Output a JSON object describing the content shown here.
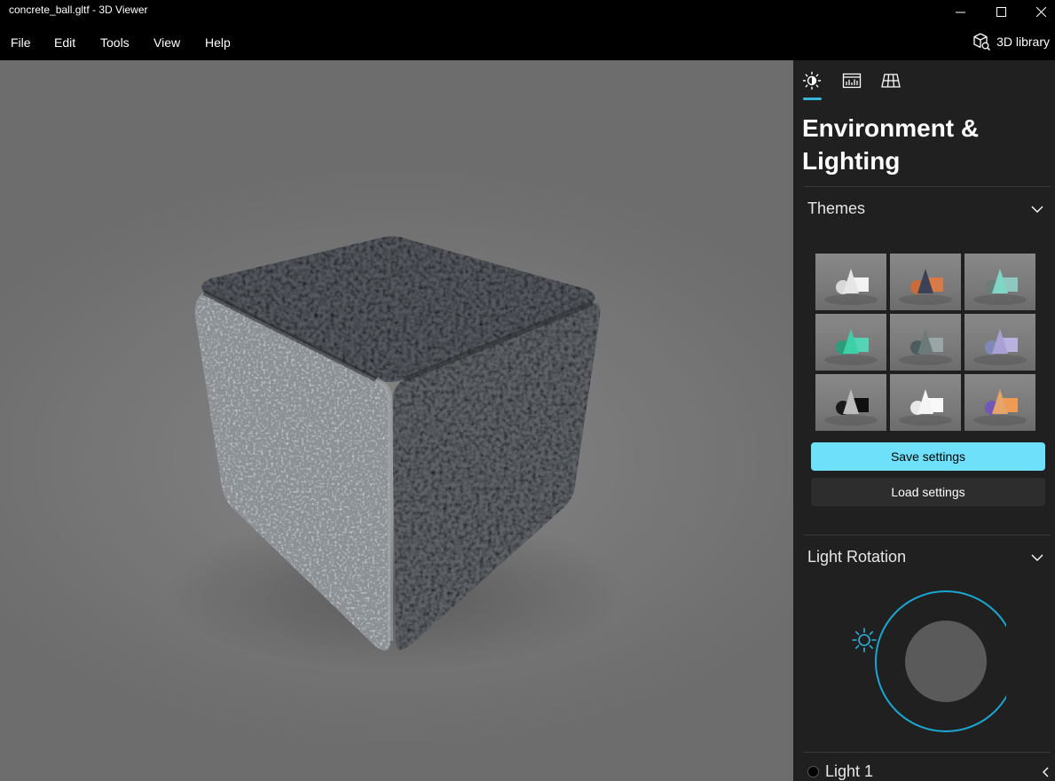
{
  "window": {
    "title": "concrete_ball.gltf - 3D Viewer"
  },
  "menu": {
    "items": [
      "File",
      "Edit",
      "Tools",
      "View",
      "Help"
    ],
    "library_label": "3D library"
  },
  "panel": {
    "tabs": [
      "environment-tab",
      "stats-tab",
      "grid-tab"
    ],
    "title": "Environment & Lighting",
    "themes": {
      "title": "Themes",
      "thumbnails": [
        {
          "colors": [
            "#d8d8d8",
            "#e6e6e6",
            "#f2f2f2"
          ]
        },
        {
          "colors": [
            "#c96b3a",
            "#3b4257",
            "#d77a45"
          ]
        },
        {
          "colors": [
            "#6b7b78",
            "#7fd6c4",
            "#8fc8c0"
          ]
        },
        {
          "colors": [
            "#2e9d7b",
            "#3bd0a8",
            "#55d3b5"
          ]
        },
        {
          "colors": [
            "#4d5c5c",
            "#6d7a7a",
            "#9aa5a5"
          ]
        },
        {
          "colors": [
            "#8088b5",
            "#a9a0d6",
            "#b8b2e0"
          ]
        },
        {
          "colors": [
            "#1a1a1a",
            "#bcbcbc",
            "#0f0f0f"
          ]
        },
        {
          "colors": [
            "#e8e8e8",
            "#f4f4f4",
            "#f8f8f8"
          ]
        },
        {
          "colors": [
            "#7057b8",
            "#e6a36a",
            "#ef9b53"
          ]
        }
      ],
      "save_label": "Save settings",
      "load_label": "Load settings"
    },
    "light_rotation": {
      "title": "Light Rotation"
    },
    "light1": {
      "label": "Light 1"
    }
  },
  "colors": {
    "accent": "#6ee0f9",
    "accent_line": "#35b5d8",
    "panel_bg": "#202020"
  }
}
